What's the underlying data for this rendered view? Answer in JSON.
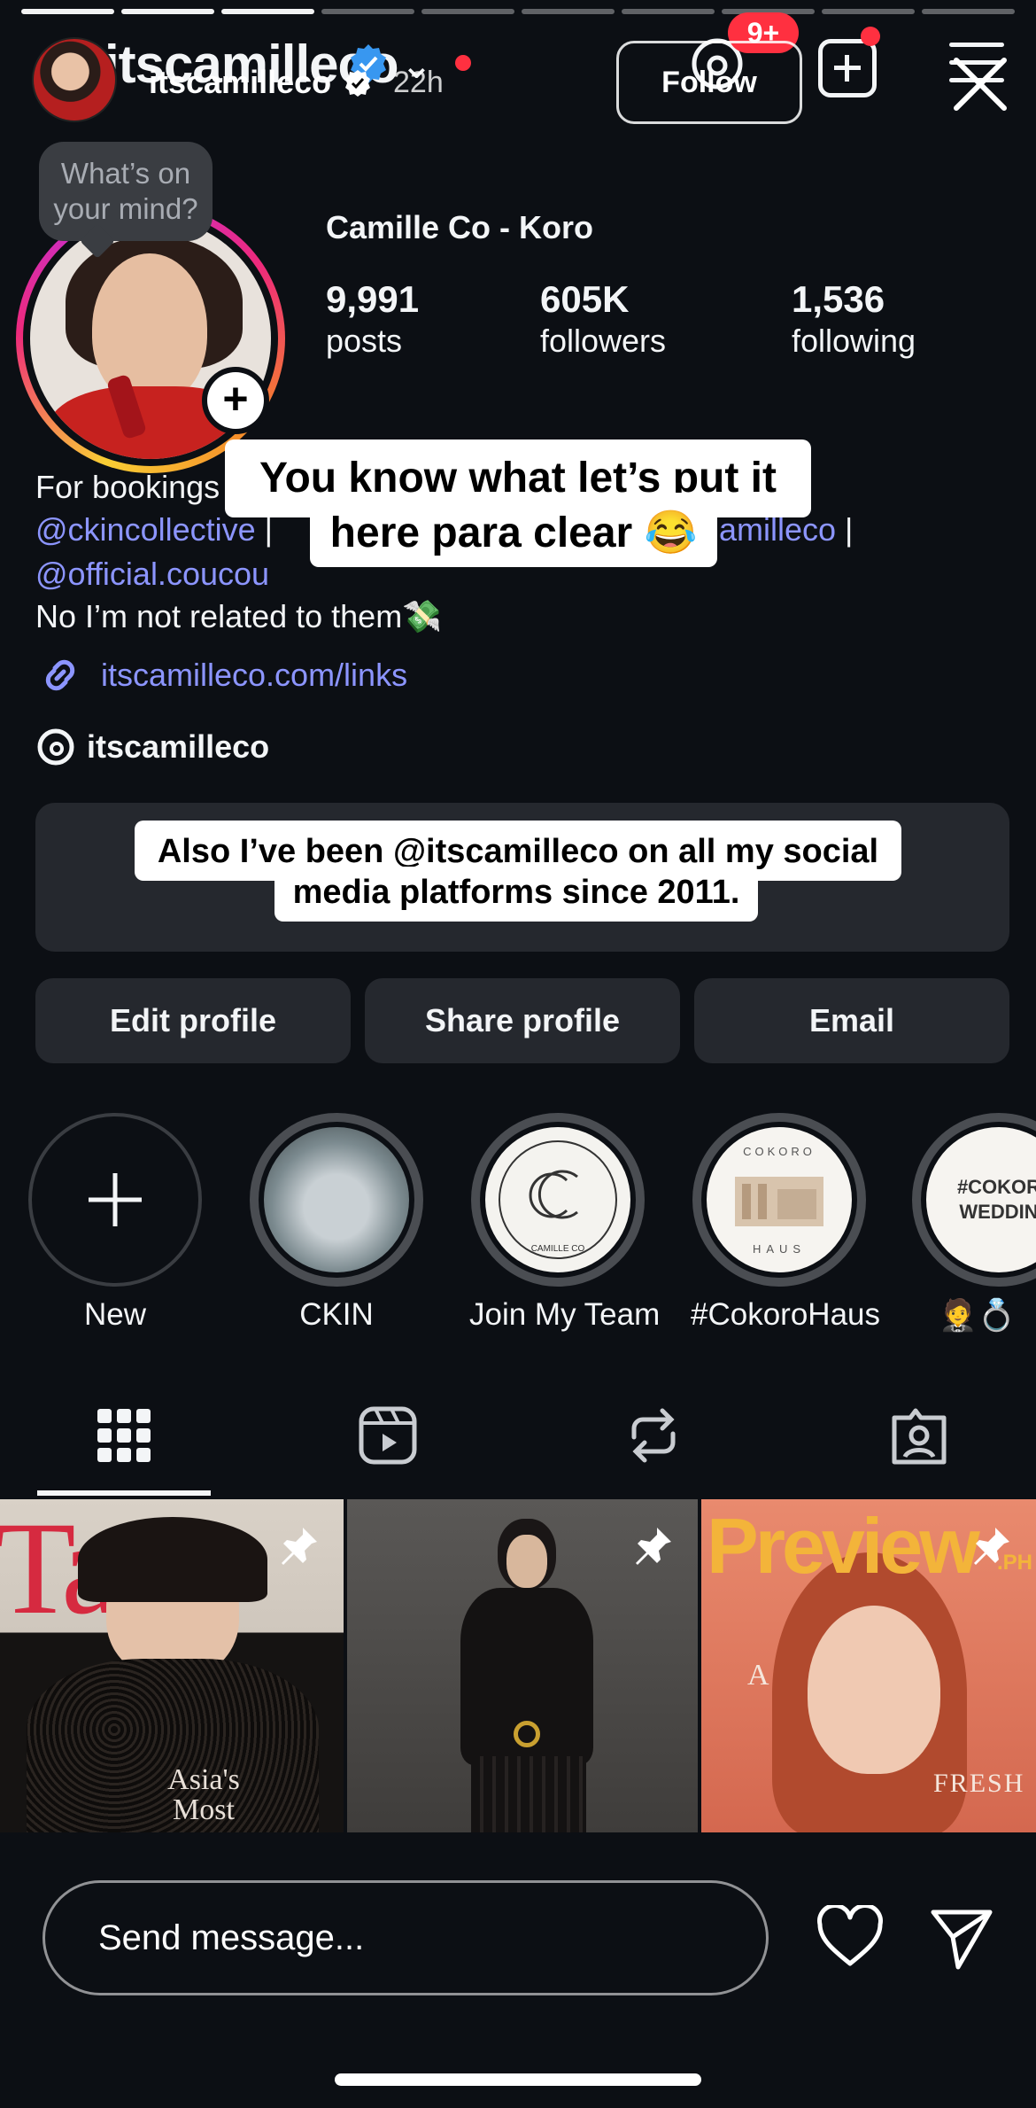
{
  "story": {
    "progress": {
      "total": 10,
      "completed": 2,
      "current": 3
    },
    "username": "itscamilleco",
    "time_ago": "22h",
    "follow_label": "Follow",
    "text_sticker_1": [
      "You know what let’s put it",
      "here para clear 😂"
    ],
    "text_sticker_2": {
      "line1_pre": "Also I’ve been ",
      "line1_handle": "@itscamilleco",
      "line1_post": "  on all my social",
      "line2": "media platforms since 2011."
    },
    "message_placeholder": "Send message..."
  },
  "profile": {
    "topbar_username": "itscamilleco",
    "notification_badge": "9+",
    "note_bubble": "What’s on your mind?",
    "full_name": "Camille Co - Koro",
    "stats": [
      {
        "value": "9,991",
        "label": "posts"
      },
      {
        "value": "605K",
        "label": "followers"
      },
      {
        "value": "1,536",
        "label": "following"
      }
    ],
    "bio": {
      "line1": "For bookings",
      "line2_a": "@ckincollective",
      "line2_b": " | ",
      "line2_c": "amilleco",
      "line2_d": " |",
      "line3": "@official.coucou",
      "line4": "No I’m not related to them💸"
    },
    "link": "itscamilleco.com/links",
    "threads_handle": "itscamilleco",
    "buttons": {
      "edit": "Edit profile",
      "share": "Share profile",
      "email": "Email"
    },
    "highlights": [
      {
        "label": "New"
      },
      {
        "label": "CKIN"
      },
      {
        "label": "Join My Team"
      },
      {
        "label": "#CokoroHaus"
      },
      {
        "label": "🤵💍"
      }
    ],
    "highlight_texts": {
      "camille_co": "CAMILLE CO",
      "cokoro_top": "COKORO",
      "cokoro_bottom": "HAUS",
      "wedding": "#COKOR WEDDIN"
    },
    "grid": [
      {
        "title_text": "Tatl",
        "caption": "Asia's Most"
      },
      {
        "title_text": ""
      },
      {
        "title_text": "Preview",
        "sub": ".PH",
        "letter": "A",
        "caption": "FRESH"
      }
    ]
  },
  "colors": {
    "background": "#0c0f14",
    "card": "#25282e",
    "link": "#8c95ff",
    "badge": "#ff3040",
    "verified": "#3897f0"
  }
}
